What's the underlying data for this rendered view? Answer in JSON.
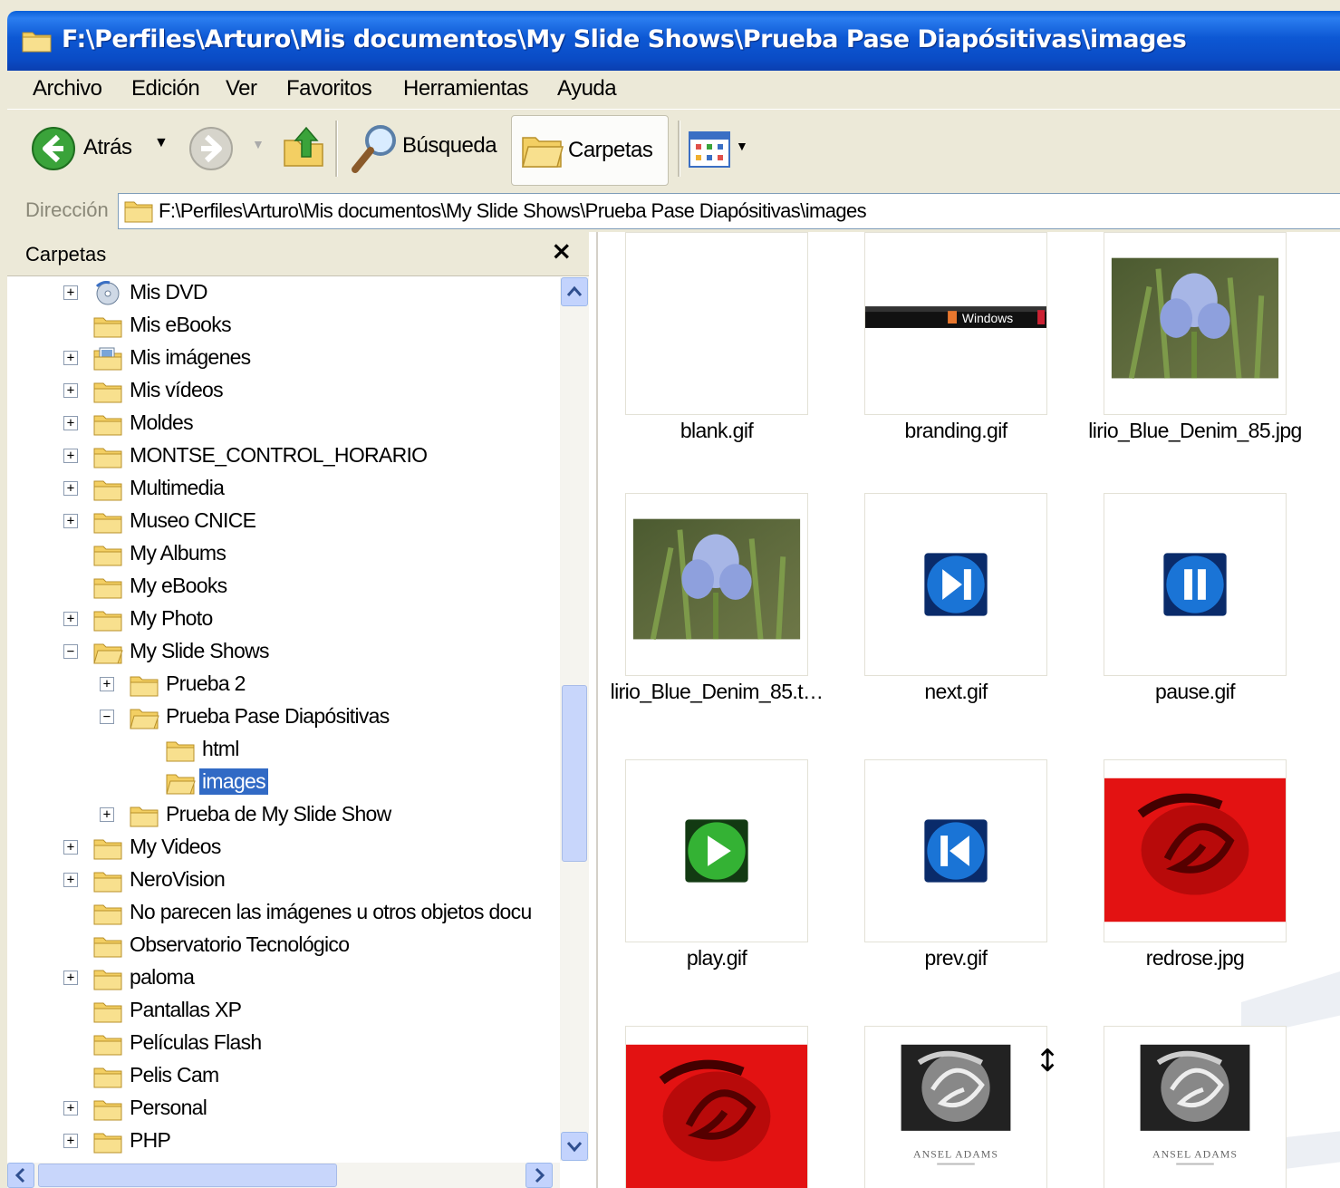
{
  "window": {
    "title": "F:\\Perfiles\\Arturo\\Mis documentos\\My Slide Shows\\Prueba  Pase Diapósitivas\\images"
  },
  "menu": [
    "Archivo",
    "Edición",
    "Ver",
    "Favoritos",
    "Herramientas",
    "Ayuda"
  ],
  "toolbar": {
    "back": "Atrás",
    "search": "Búsqueda",
    "folders": "Carpetas"
  },
  "address": {
    "label": "Dirección",
    "value": "F:\\Perfiles\\Arturo\\Mis documentos\\My Slide Shows\\Prueba  Pase Diapósitivas\\images"
  },
  "folder_pane": {
    "title": "Carpetas",
    "close": "×",
    "items": [
      {
        "label": "Mis DVD",
        "exp": "+"
      },
      {
        "label": "Mis eBooks",
        "exp": ""
      },
      {
        "label": "Mis imágenes",
        "exp": "+"
      },
      {
        "label": "Mis vídeos",
        "exp": "+"
      },
      {
        "label": "Moldes",
        "exp": "+"
      },
      {
        "label": "MONTSE_CONTROL_HORARIO",
        "exp": "+"
      },
      {
        "label": "Multimedia",
        "exp": "+"
      },
      {
        "label": "Museo CNICE",
        "exp": "+"
      },
      {
        "label": "My Albums",
        "exp": ""
      },
      {
        "label": "My eBooks",
        "exp": ""
      },
      {
        "label": "My Photo",
        "exp": "+"
      },
      {
        "label": "My Slide Shows",
        "exp": "−"
      },
      {
        "label": "Prueba 2",
        "exp": "+"
      },
      {
        "label": "Prueba  Pase Diapósitivas",
        "exp": "−"
      },
      {
        "label": "html",
        "exp": ""
      },
      {
        "label": "images",
        "exp": ""
      },
      {
        "label": "Prueba de My Slide Show",
        "exp": "+"
      },
      {
        "label": "My Videos",
        "exp": "+"
      },
      {
        "label": "NeroVision",
        "exp": "+"
      },
      {
        "label": "No parecen las imágenes u otros objetos docu",
        "exp": ""
      },
      {
        "label": "Observatorio Tecnológico",
        "exp": ""
      },
      {
        "label": "paloma",
        "exp": "+"
      },
      {
        "label": "Pantallas XP",
        "exp": ""
      },
      {
        "label": "Películas Flash",
        "exp": ""
      },
      {
        "label": "Pelis Cam",
        "exp": ""
      },
      {
        "label": "Personal",
        "exp": "+"
      },
      {
        "label": "PHP",
        "exp": "+"
      }
    ]
  },
  "files": [
    {
      "name": "blank.gif",
      "kind": "blank"
    },
    {
      "name": "branding.gif",
      "kind": "branding"
    },
    {
      "name": "lirio_Blue_Denim_85.jpg",
      "kind": "iris"
    },
    {
      "name": "lirio_Blue_Denim_85.t…",
      "kind": "iris"
    },
    {
      "name": "next.gif",
      "kind": "next"
    },
    {
      "name": "pause.gif",
      "kind": "pause"
    },
    {
      "name": "play.gif",
      "kind": "play"
    },
    {
      "name": "prev.gif",
      "kind": "prev"
    },
    {
      "name": "redrose.jpg",
      "kind": "rose"
    },
    {
      "name": "",
      "kind": "rose"
    },
    {
      "name": "",
      "kind": "adams"
    },
    {
      "name": "",
      "kind": "adams"
    }
  ],
  "branding_text": "Windows",
  "adams_caption": "ANSEL ADAMS",
  "colors": {
    "title_blue": "#0a4cc6",
    "selection": "#316ac5",
    "folder_yellow": "#f5d36a"
  }
}
